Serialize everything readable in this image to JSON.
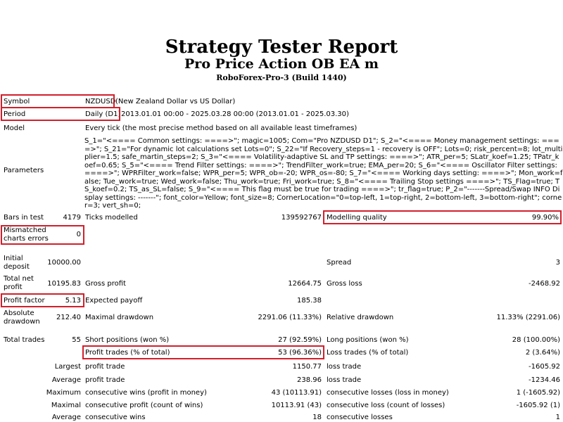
{
  "header": {
    "title": "Strategy Tester Report",
    "subtitle": "Pro Price Action OB EA m",
    "server": "RoboForex-Pro-3 (Build 1440)"
  },
  "symbol": {
    "label": "Symbol",
    "code": "NZDUSD",
    "desc": "(New Zealand Dollar vs US Dollar)"
  },
  "period": {
    "label": "Period",
    "value": "Daily (D1)",
    "range": "2013.01.01 00:00 - 2025.03.28 00:00 (2013.01.01 - 2025.03.30)"
  },
  "model": {
    "label": "Model",
    "value": "Every tick (the most precise method based on all available least timeframes)"
  },
  "parameters": {
    "label": "Parameters",
    "text": "S_1=\"<==== Common settings: ====>\"; magic=1005; Com=\"Pro NZDUSD D1\"; S_2=\"<==== Money management settings: ====>\"; S_21=\"For dynamic lot calculations set Lots=0\"; S_22=\"If Recovery_steps=1 - recovery is OFF\"; Lots=0; risk_percent=8; lot_multiplier=1.5; safe_martin_steps=2; S_3=\"<==== Volatility-adaptive SL and TP settings: ====>\"; ATR_per=5; SLatr_koef=1.25; TPatr_koef=0.65; S_5=\"<==== Trend Filter settings: ====>\"; TrendFilter_work=true; EMA_per=20; S_6=\"<==== Oscillator Filter settings: ====>\"; WPRFilter_work=false; WPR_per=5; WPR_ob=-20; WPR_os=-80; S_7=\"<==== Working days setting: ====>\"; Mon_work=false; Tue_work=true; Wed_work=false; Thu_work=true; Fri_work=true; S_8=\"<==== Trailing Stop settings ====>\"; TS_Flag=true; TS_koef=0.2; TS_as_SL=false; S_9=\"<==== This flag must be true for trading ====>\"; tr_flag=true; P_2=\"-------Spread/Swap INFO Display settings: -------\"; font_color=Yellow; font_size=8; CornerLocation=\"0=top-left, 1=top-right, 2=bottom-left, 3=bottom-right\"; corner=3; vert_sh=0;"
  },
  "bars": {
    "label": "Bars in test",
    "value": "4179"
  },
  "ticks": {
    "label": "Ticks modelled",
    "value": "139592767"
  },
  "quality": {
    "label": "Modelling quality",
    "value": "99.90%"
  },
  "mismatched": {
    "label": "Mismatched charts errors",
    "value": "0"
  },
  "initial": {
    "label": "Initial deposit",
    "value": "10000.00"
  },
  "spread": {
    "label": "Spread",
    "value": "3"
  },
  "netprofit": {
    "label": "Total net profit",
    "value": "10195.83"
  },
  "grossprofit": {
    "label": "Gross profit",
    "value": "12664.75"
  },
  "grossloss": {
    "label": "Gross loss",
    "value": "-2468.92"
  },
  "pf": {
    "label": "Profit factor",
    "value": "5.13"
  },
  "ep": {
    "label": "Expected payoff",
    "value": "185.38"
  },
  "absdd": {
    "label": "Absolute drawdown",
    "value": "212.40"
  },
  "maxdd": {
    "label": "Maximal drawdown",
    "value": "2291.06 (11.33%)"
  },
  "reldd": {
    "label": "Relative drawdown",
    "value": "11.33% (2291.06)"
  },
  "trades": {
    "label": "Total trades",
    "value": "55"
  },
  "short": {
    "label": "Short positions (won %)",
    "value": "27 (92.59%)"
  },
  "long": {
    "label": "Long positions (won %)",
    "value": "28 (100.00%)"
  },
  "ptrades": {
    "label": "Profit trades (% of total)",
    "value": "53 (96.36%)"
  },
  "ltrades": {
    "label": "Loss trades (% of total)",
    "value": "2 (3.64%)"
  },
  "rows": [
    {
      "pre": "Largest",
      "l1": "profit trade",
      "v1": "1150.77",
      "l2": "loss trade",
      "v2": "-1605.92"
    },
    {
      "pre": "Average",
      "l1": "profit trade",
      "v1": "238.96",
      "l2": "loss trade",
      "v2": "-1234.46"
    },
    {
      "pre": "Maximum",
      "l1": "consecutive wins (profit in money)",
      "v1": "43 (10113.91)",
      "l2": "consecutive losses (loss in money)",
      "v2": "1 (-1605.92)"
    },
    {
      "pre": "Maximal",
      "l1": "consecutive profit (count of wins)",
      "v1": "10113.91 (43)",
      "l2": "consecutive loss (count of losses)",
      "v2": "-1605.92 (1)"
    },
    {
      "pre": "Average",
      "l1": "consecutive wins",
      "v1": "18",
      "l2": "consecutive losses",
      "v2": "1"
    }
  ]
}
